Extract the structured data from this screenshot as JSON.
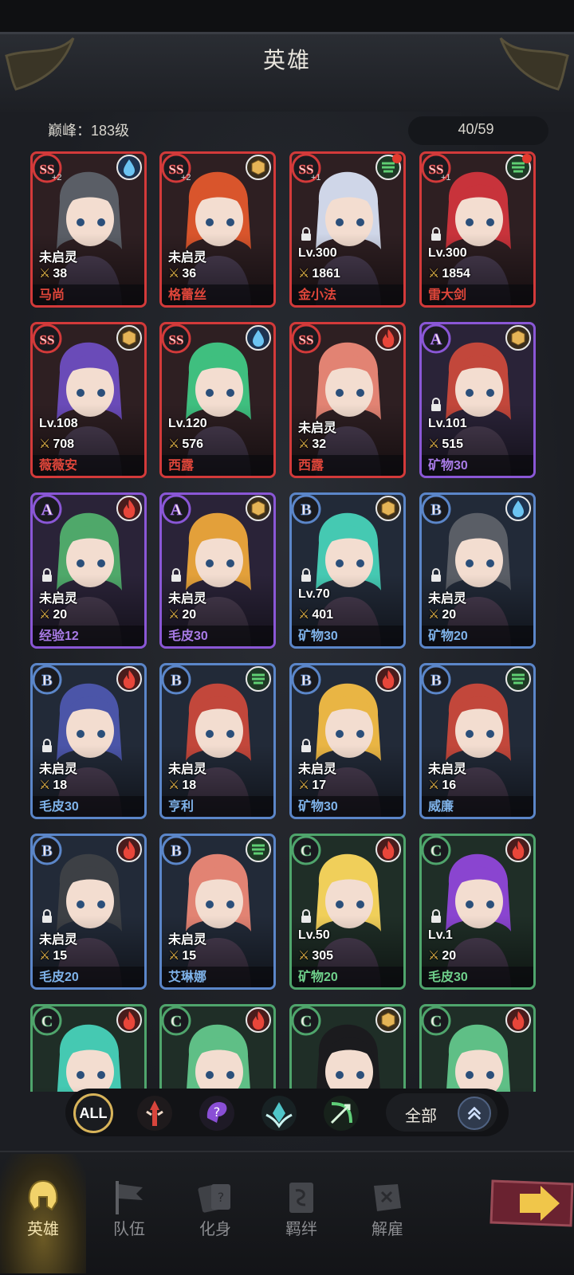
{
  "header": {
    "title": "英雄"
  },
  "summary": {
    "peak_label": "巅峰：183级",
    "hero_count": "40/59"
  },
  "heroes": [
    {
      "rank": "SS",
      "element": "water",
      "plus": "+2",
      "status": "未启灵",
      "power": "38",
      "name": "马尚",
      "name_color": "red",
      "locked": false
    },
    {
      "rank": "SS",
      "element": "earth",
      "plus": "+2",
      "status": "未启灵",
      "power": "36",
      "name": "格蕾丝",
      "name_color": "red",
      "locked": false
    },
    {
      "rank": "SS",
      "element": "wind",
      "plus": "+1",
      "status": "Lv.300",
      "power": "1861",
      "name": "金小法",
      "name_color": "red",
      "locked": true,
      "dot": true
    },
    {
      "rank": "SS",
      "element": "wind",
      "plus": "+1",
      "status": "Lv.300",
      "power": "1854",
      "name": "雷大剑",
      "name_color": "red",
      "locked": true,
      "dot": true
    },
    {
      "rank": "SS",
      "element": "earth",
      "plus": "",
      "status": "Lv.108",
      "power": "708",
      "name": "薇薇安",
      "name_color": "red",
      "locked": false
    },
    {
      "rank": "SS",
      "element": "water",
      "plus": "",
      "status": "Lv.120",
      "power": "576",
      "name": "西露",
      "name_color": "red",
      "locked": false
    },
    {
      "rank": "SS",
      "element": "fire",
      "plus": "",
      "status": "未启灵",
      "power": "32",
      "name": "西露",
      "name_color": "red",
      "locked": false
    },
    {
      "rank": "A",
      "element": "earth",
      "plus": "",
      "status": "Lv.101",
      "power": "515",
      "name": "矿物30",
      "name_color": "purple",
      "locked": true
    },
    {
      "rank": "A",
      "element": "fire",
      "plus": "",
      "status": "未启灵",
      "power": "20",
      "name": "经验12",
      "name_color": "purple",
      "locked": true
    },
    {
      "rank": "A",
      "element": "earth",
      "plus": "",
      "status": "未启灵",
      "power": "20",
      "name": "毛皮30",
      "name_color": "purple",
      "locked": true
    },
    {
      "rank": "B",
      "element": "earth",
      "plus": "",
      "status": "Lv.70",
      "power": "401",
      "name": "矿物30",
      "name_color": "blue",
      "locked": true
    },
    {
      "rank": "B",
      "element": "water",
      "plus": "",
      "status": "未启灵",
      "power": "20",
      "name": "矿物20",
      "name_color": "blue",
      "locked": true
    },
    {
      "rank": "B",
      "element": "fire",
      "plus": "",
      "status": "未启灵",
      "power": "18",
      "name": "毛皮30",
      "name_color": "blue",
      "locked": true
    },
    {
      "rank": "B",
      "element": "wind",
      "plus": "",
      "status": "未启灵",
      "power": "18",
      "name": "亨利",
      "name_color": "blue",
      "locked": false
    },
    {
      "rank": "B",
      "element": "fire",
      "plus": "",
      "status": "未启灵",
      "power": "17",
      "name": "矿物30",
      "name_color": "blue",
      "locked": true
    },
    {
      "rank": "B",
      "element": "wind",
      "plus": "",
      "status": "未启灵",
      "power": "16",
      "name": "威廉",
      "name_color": "blue",
      "locked": false
    },
    {
      "rank": "B",
      "element": "fire",
      "plus": "",
      "status": "未启灵",
      "power": "15",
      "name": "毛皮20",
      "name_color": "blue",
      "locked": true
    },
    {
      "rank": "B",
      "element": "wind",
      "plus": "",
      "status": "未启灵",
      "power": "15",
      "name": "艾琳娜",
      "name_color": "blue",
      "locked": false
    },
    {
      "rank": "C",
      "element": "fire",
      "plus": "",
      "status": "Lv.50",
      "power": "305",
      "name": "矿物20",
      "name_color": "green",
      "locked": true
    },
    {
      "rank": "C",
      "element": "fire",
      "plus": "",
      "status": "Lv.1",
      "power": "20",
      "name": "毛皮30",
      "name_color": "green",
      "locked": true
    },
    {
      "rank": "C",
      "element": "fire",
      "plus": "",
      "status": "",
      "power": "",
      "name": "",
      "name_color": "green",
      "locked": false
    },
    {
      "rank": "C",
      "element": "fire",
      "plus": "",
      "status": "",
      "power": "",
      "name": "",
      "name_color": "green",
      "locked": false
    },
    {
      "rank": "C",
      "element": "earth",
      "plus": "",
      "status": "",
      "power": "",
      "name": "",
      "name_color": "green",
      "locked": false
    },
    {
      "rank": "C",
      "element": "fire",
      "plus": "",
      "status": "",
      "power": "",
      "name": "",
      "name_color": "green",
      "locked": false
    }
  ],
  "filter": {
    "all_label": "ALL",
    "sort_label": "全部"
  },
  "nav": [
    {
      "label": "英雄",
      "active": true
    },
    {
      "label": "队伍",
      "active": false
    },
    {
      "label": "化身",
      "active": false
    },
    {
      "label": "羁绊",
      "active": false
    },
    {
      "label": "解雇",
      "active": false
    }
  ],
  "colors": {
    "SS": "#d33a3a",
    "A": "#8a57d6",
    "B": "#5b86c9",
    "C": "#4fa56c",
    "accent": "#d8b45a"
  }
}
